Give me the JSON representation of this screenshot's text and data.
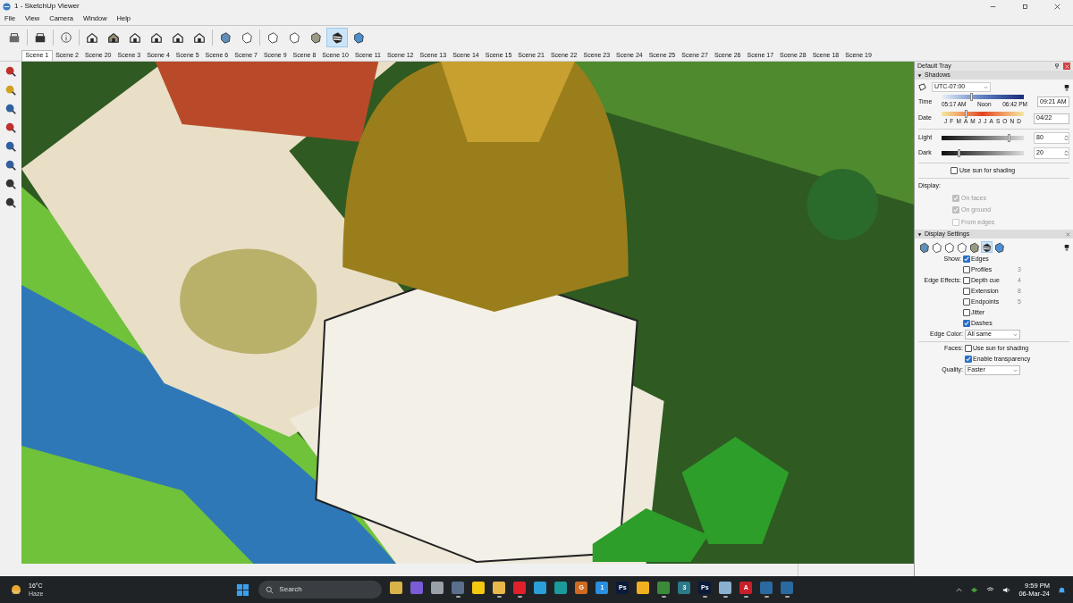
{
  "window": {
    "title": "1 - SketchUp Viewer"
  },
  "menu": [
    "File",
    "View",
    "Camera",
    "Window",
    "Help"
  ],
  "toolbar": {
    "buttons": [
      {
        "selected": false
      },
      {
        "selected": false
      },
      {
        "selected": false
      },
      {
        "selected": false
      },
      {
        "selected": false
      },
      {
        "selected": false
      },
      {
        "selected": false
      },
      {
        "selected": false
      },
      {
        "selected": false
      },
      {
        "selected": false
      },
      {
        "selected": false
      },
      {
        "selected": false
      },
      {
        "selected": false
      },
      {
        "selected": false
      },
      {
        "selected": true
      },
      {
        "selected": false
      }
    ]
  },
  "scenes": [
    {
      "label": "Scene 1",
      "selected": true
    },
    {
      "label": "Scene 2",
      "selected": false
    },
    {
      "label": "Scene 20",
      "selected": false
    },
    {
      "label": "Scene 3",
      "selected": false
    },
    {
      "label": "Scene 4",
      "selected": false
    },
    {
      "label": "Scene 5",
      "selected": false
    },
    {
      "label": "Scene 6",
      "selected": false
    },
    {
      "label": "Scene 7",
      "selected": false
    },
    {
      "label": "Scene 9",
      "selected": false
    },
    {
      "label": "Scene 8",
      "selected": false
    },
    {
      "label": "Scene 10",
      "selected": false
    },
    {
      "label": "Scene 11",
      "selected": false
    },
    {
      "label": "Scene 12",
      "selected": false
    },
    {
      "label": "Scene 13",
      "selected": false
    },
    {
      "label": "Scene 14",
      "selected": false
    },
    {
      "label": "Scene 15",
      "selected": false
    },
    {
      "label": "Scene 21",
      "selected": false
    },
    {
      "label": "Scene 22",
      "selected": false
    },
    {
      "label": "Scene 23",
      "selected": false
    },
    {
      "label": "Scene 24",
      "selected": false
    },
    {
      "label": "Scene 25",
      "selected": false
    },
    {
      "label": "Scene 27",
      "selected": false
    },
    {
      "label": "Scene 26",
      "selected": false
    },
    {
      "label": "Scene 17",
      "selected": false
    },
    {
      "label": "Scene 28",
      "selected": false
    },
    {
      "label": "Scene 18",
      "selected": false
    },
    {
      "label": "Scene 19",
      "selected": false
    }
  ],
  "tray": {
    "title": "Default Tray",
    "shadows": {
      "title": "Shadows",
      "timezone": "UTC-07:00",
      "time_label": "Time",
      "time_ticks": [
        "05:17 AM",
        "Noon",
        "06:42 PM"
      ],
      "time_slider": {
        "level": 0.35
      },
      "time_value": "09:21 AM",
      "date_label": "Date",
      "months": [
        "J",
        "F",
        "M",
        "A",
        "M",
        "J",
        "J",
        "A",
        "S",
        "O",
        "N",
        "D"
      ],
      "date_slider": {
        "level": 0.28
      },
      "date_value": "04/22",
      "light_label": "Light",
      "light_slider": {
        "level": 0.8
      },
      "light_value": "80",
      "dark_label": "Dark",
      "dark_slider": {
        "level": 0.2
      },
      "dark_value": "20",
      "use_sun": {
        "label": "Use sun for shading",
        "checked": false
      },
      "display_label": "Display:",
      "display_options": [
        {
          "label": "On faces",
          "checked": true,
          "disabled": true
        },
        {
          "label": "On ground",
          "checked": true,
          "disabled": true
        },
        {
          "label": "From edges",
          "checked": false,
          "disabled": true
        }
      ]
    },
    "display_settings": {
      "title": "Display Settings",
      "styles": [
        {
          "selected": false
        },
        {
          "selected": false
        },
        {
          "selected": false
        },
        {
          "selected": false
        },
        {
          "selected": false
        },
        {
          "selected": true
        },
        {
          "selected": false
        }
      ],
      "show_label": "Show:",
      "edge_effects_label": "Edge Effects:",
      "edges": [
        {
          "label": "Edges",
          "checked": true
        },
        {
          "label": "Profiles",
          "checked": false,
          "value": "3"
        },
        {
          "label": "Depth cue",
          "checked": false,
          "value": "4"
        },
        {
          "label": "Extension",
          "checked": false,
          "value": "8"
        },
        {
          "label": "Endpoints",
          "checked": false,
          "value": "5"
        },
        {
          "label": "Jitter",
          "checked": false
        },
        {
          "label": "Dashes",
          "checked": true
        }
      ],
      "edge_color_label": "Edge Color:",
      "edge_color": "All same",
      "faces_label": "Faces:",
      "faces": [
        {
          "label": "Use sun for shading",
          "checked": false
        },
        {
          "label": "Enable transparency",
          "checked": true
        }
      ],
      "quality_label": "Quality:",
      "quality": "Faster"
    }
  },
  "taskbar": {
    "temperature": "16°C",
    "weather": "Haze",
    "search_placeholder": "Search",
    "apps": [
      {
        "color": "#d9b34a",
        "active": false
      },
      {
        "color": "#7a5cd6",
        "active": false
      },
      {
        "color": "#9aa0a8",
        "active": false
      },
      {
        "color": "#5a6f8c",
        "active": true
      },
      {
        "color": "#f2c811",
        "active": false
      },
      {
        "color": "#e8b84a",
        "active": true
      },
      {
        "color": "#e0202a",
        "active": true
      },
      {
        "color": "#2a9fd8",
        "active": false
      },
      {
        "color": "#1a9a9a",
        "active": false
      },
      {
        "color": "#d06a20",
        "active": false,
        "label": "G"
      },
      {
        "color": "#2a8fe0",
        "active": false,
        "label": "1"
      },
      {
        "color": "#0a1a3a",
        "active": false,
        "label": "Ps"
      },
      {
        "color": "#f0b020",
        "active": false
      },
      {
        "color": "#3a8a3a",
        "active": true
      },
      {
        "color": "#2a7a8a",
        "active": false,
        "label": "3"
      },
      {
        "color": "#0a1a3a",
        "active": true,
        "label": "Ps"
      },
      {
        "color": "#8ab0d0",
        "active": true
      },
      {
        "color": "#c8202a",
        "active": true,
        "label": "A"
      },
      {
        "color": "#2a6aa0",
        "active": true
      },
      {
        "color": "#2a6aa0",
        "active": true
      }
    ],
    "time": "9:59 PM",
    "date": "06-Mar-24"
  }
}
